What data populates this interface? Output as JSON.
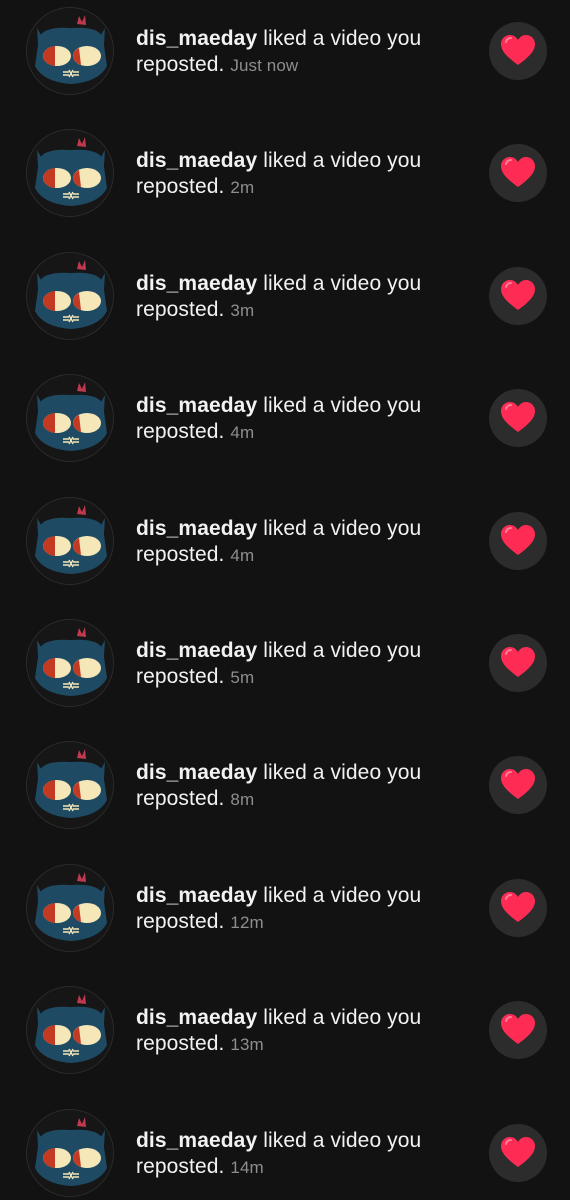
{
  "activity": {
    "items": [
      {
        "username": "dis_maeday",
        "action": "liked a video you reposted.",
        "time": "Just now"
      },
      {
        "username": "dis_maeday",
        "action": "liked a video you reposted.",
        "time": "2m"
      },
      {
        "username": "dis_maeday",
        "action": "liked a video you reposted.",
        "time": "3m"
      },
      {
        "username": "dis_maeday",
        "action": "liked a video you reposted.",
        "time": "4m"
      },
      {
        "username": "dis_maeday",
        "action": "liked a video you reposted.",
        "time": "4m"
      },
      {
        "username": "dis_maeday",
        "action": "liked a video you reposted.",
        "time": "5m"
      },
      {
        "username": "dis_maeday",
        "action": "liked a video you reposted.",
        "time": "8m"
      },
      {
        "username": "dis_maeday",
        "action": "liked a video you reposted.",
        "time": "12m"
      },
      {
        "username": "dis_maeday",
        "action": "liked a video you reposted.",
        "time": "13m"
      },
      {
        "username": "dis_maeday",
        "action": "liked a video you reposted.",
        "time": "14m"
      }
    ],
    "icons": {
      "avatar": "cat-avatar-icon",
      "like": "heart-icon"
    },
    "colors": {
      "background": "#121212",
      "heart": "#fe2c55",
      "timestamp": "#8e8e8e"
    }
  }
}
